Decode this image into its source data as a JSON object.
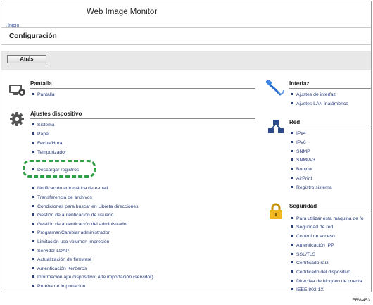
{
  "app_title": "Web Image Monitor",
  "breadcrumb": {
    "link_label": "Inicio"
  },
  "page_title": "Configuración",
  "toolbar": {
    "back_label": "Atrás"
  },
  "highlight_color": "#2ea043",
  "link_color": "#2c3f7a",
  "left_column": {
    "pantalla": {
      "heading": "Pantalla",
      "icon": "monitor-gear-icon",
      "items": [
        "Pantalla"
      ]
    },
    "ajustes": {
      "heading": "Ajustes dispositivo",
      "icon": "gear-icon",
      "items": [
        "Sistema",
        "Papel",
        "Fecha/Hora",
        "Temporizador",
        "Descargar registros",
        "Notificación automática de e-mail",
        "Transferencia de archivos",
        "Condiciones para buscar en Libreta direcciones",
        "Gestión de autenticación de usuario",
        "Gestión de autenticación del administrador",
        "Programar/Cambiar administrador",
        "Limitación uso volumen impresión",
        "Servidor LDAP",
        "Actualización de firmware",
        "Autenticación Kerberos",
        "Información ajte dispositivo: Ajte importación (servidor)",
        "Prueba de importación"
      ]
    }
  },
  "right_column": {
    "interfaz": {
      "heading": "Interfaz",
      "icon": "network-cable-icon",
      "items": [
        "Ajustes de interfaz",
        "Ajustes LAN inalámbrica"
      ]
    },
    "red": {
      "heading": "Red",
      "icon": "network-nodes-icon",
      "items": [
        "IPv4",
        "IPv6",
        "SNMP",
        "SNMPv3",
        "Bonjour",
        "AirPrint",
        "Registro sistema"
      ]
    },
    "seguridad": {
      "heading": "Seguridad",
      "icon": "padlock-icon",
      "items": [
        "Para utilizar esta máquina de fo",
        "Seguridad de red",
        "Control de acceso",
        "Autenticación IPP",
        "SSL/TLS",
        "Certificado raíz",
        "Certificado del dispositivo",
        "Directiva de bloqueo de cuenta",
        "IEEE 802.1X"
      ]
    }
  },
  "figure_code": "EBW453"
}
